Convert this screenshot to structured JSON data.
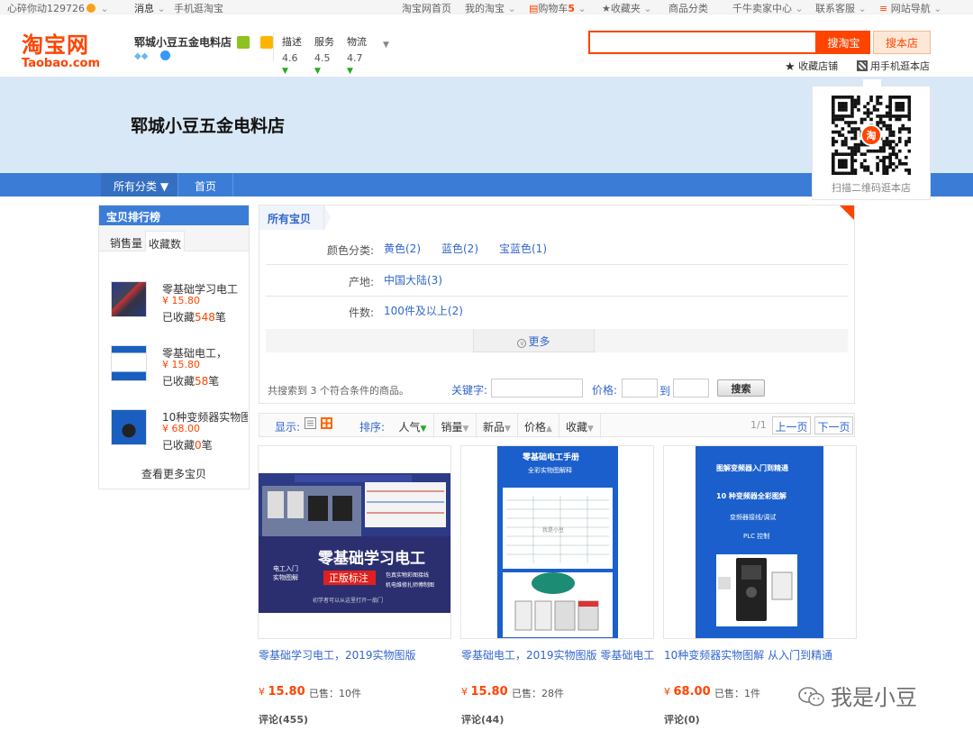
{
  "topbar": {
    "user": "心碎你动129726",
    "messages": "消息",
    "mobile": "手机逛淘宝",
    "home": "淘宝网首页",
    "my_taobao": "我的淘宝",
    "cart_label": "购物车",
    "cart_count": "5",
    "favorites": "收藏夹",
    "categories": "商品分类",
    "seller_center": "千牛卖家中心",
    "support": "联系客服",
    "site_nav": "网站导航"
  },
  "header": {
    "logo_cn": "淘宝网",
    "logo_en": "Taobao.com",
    "shop_name": "郓城小豆五金电料店",
    "rating_labels": [
      "描述",
      "服务",
      "物流"
    ],
    "rating_values": [
      "4.6",
      "4.5",
      "4.7"
    ],
    "search_taobao_label": "搜淘宝",
    "search_shop_label": "搜本店",
    "search_value": "",
    "fav_store": "收藏店铺",
    "mobile_store": "用手机逛本店"
  },
  "banner": {
    "title": "郓城小豆五金电料店",
    "qr_caption": "扫描二维码逛本店",
    "qr_center_char": "淘"
  },
  "nav": {
    "all_categories": "所有分类",
    "home": "首页"
  },
  "sidebar": {
    "title": "宝贝排行榜",
    "tabs": [
      "销售量",
      "收藏数"
    ],
    "items": [
      {
        "name": "零基础学习电工",
        "price": "¥ 15.80",
        "fav_prefix": "已收藏",
        "fav_count": "548",
        "fav_suffix": "笔"
      },
      {
        "name": "零基础电工，",
        "price": "¥ 15.80",
        "fav_prefix": "已收藏",
        "fav_count": "58",
        "fav_suffix": "笔"
      },
      {
        "name": "10种变频器实物图",
        "price": "¥ 68.00",
        "fav_prefix": "已收藏",
        "fav_count": "0",
        "fav_suffix": "笔"
      }
    ],
    "more": "查看更多宝贝"
  },
  "filter": {
    "tab": "所有宝贝",
    "rows": [
      {
        "label": "颜色分类:",
        "values": [
          "黄色(2)",
          "蓝色(2)",
          "宝蓝色(1)"
        ]
      },
      {
        "label": "产地:",
        "values": [
          "中国大陆(3)"
        ]
      },
      {
        "label": "件数:",
        "values": [
          "100件及以上(2)"
        ]
      }
    ],
    "more": "更多",
    "result_count": "共搜索到 3 个符合条件的商品。",
    "keyword_label": "关键字:",
    "keyword_value": "",
    "price_label": "价格:",
    "price_to": "到",
    "search_button": "搜索"
  },
  "toolbar": {
    "display_label": "显示:",
    "sort_label": "排序:",
    "sorts": [
      "人气",
      "销量",
      "新品",
      "价格",
      "收藏"
    ],
    "page_count": "1/1",
    "prev": "上一页",
    "next": "下一页"
  },
  "products": [
    {
      "title": "零基础学习电工，2019实物图版",
      "price": "15.80",
      "sold": "已售：10件",
      "reviews": "评论(455)",
      "img_lines": [
        "零基础学习电工",
        "正版标注",
        "电工入门",
        "实物图解",
        "包真实物彩图接线",
        "机电维修扎师傅制图",
        "初学者可以从这里打开一扇门"
      ]
    },
    {
      "title": "零基础电工，2019实物图版 零基础电工",
      "price": "15.80",
      "sold": "已售：28件",
      "reviews": "评论(44)",
      "img_lines": [
        "零基础电工手册",
        "全彩实物图解释",
        "我是小豆"
      ]
    },
    {
      "title": "10种变频器实物图解 从入门到精通",
      "price": "68.00",
      "sold": "已售：1件",
      "reviews": "评论(0)",
      "img_lines": [
        "图解变频器入门到精通",
        "10 种变频器全彩图解",
        "变频器接线/调试",
        "PLC 控制"
      ]
    }
  ],
  "currency": "¥",
  "watermark": "我是小豆",
  "colors": {
    "brand": "#ff4400",
    "nav_blue": "#3b7dd6",
    "link": "#3366cc",
    "banner_bg": "#d9e8f7"
  }
}
